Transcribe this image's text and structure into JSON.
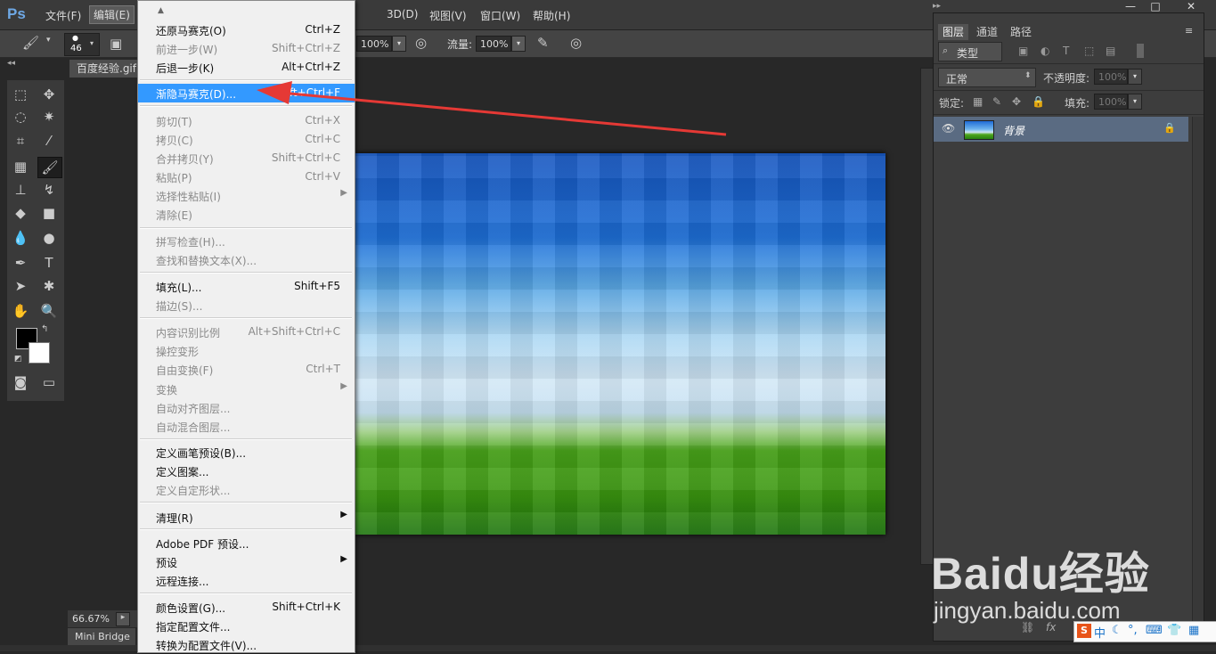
{
  "app": {
    "logo": "Ps",
    "accent": "#6ea8e5"
  },
  "menubar": {
    "items": [
      "文件(F)",
      "编辑(E)",
      "3D(D)",
      "视图(V)",
      "窗口(W)",
      "帮助(H)"
    ],
    "active_index": 1,
    "window_controls": [
      "—",
      "□",
      "✕"
    ]
  },
  "options": {
    "brush_size": "46",
    "opacity_value": "100%",
    "flow_label": "流量:",
    "flow_value": "100%"
  },
  "document": {
    "tab_title": "百度经验.gif",
    "zoom": "66.67%",
    "mini_bridge": "Mini Bridge"
  },
  "edit_menu": {
    "items": [
      {
        "label": "还原马赛克(O)",
        "shortcut": "Ctrl+Z",
        "disabled": false
      },
      {
        "label": "前进一步(W)",
        "shortcut": "Shift+Ctrl+Z",
        "disabled": true
      },
      {
        "label": "后退一步(K)",
        "shortcut": "Alt+Ctrl+Z",
        "disabled": false
      },
      {
        "label": "渐隐马赛克(D)...",
        "shortcut": "Shift+Ctrl+F",
        "disabled": false,
        "highlighted": true
      },
      {
        "label": "剪切(T)",
        "shortcut": "Ctrl+X",
        "disabled": true
      },
      {
        "label": "拷贝(C)",
        "shortcut": "Ctrl+C",
        "disabled": true
      },
      {
        "label": "合并拷贝(Y)",
        "shortcut": "Shift+Ctrl+C",
        "disabled": true
      },
      {
        "label": "粘贴(P)",
        "shortcut": "Ctrl+V",
        "disabled": true
      },
      {
        "label": "选择性粘贴(I)",
        "shortcut": "",
        "disabled": true,
        "submenu": true
      },
      {
        "label": "清除(E)",
        "shortcut": "",
        "disabled": true
      },
      {
        "label": "拼写检查(H)...",
        "shortcut": "",
        "disabled": true
      },
      {
        "label": "查找和替换文本(X)...",
        "shortcut": "",
        "disabled": true
      },
      {
        "label": "填充(L)...",
        "shortcut": "Shift+F5",
        "disabled": false
      },
      {
        "label": "描边(S)...",
        "shortcut": "",
        "disabled": true
      },
      {
        "label": "内容识别比例",
        "shortcut": "Alt+Shift+Ctrl+C",
        "disabled": true
      },
      {
        "label": "操控变形",
        "shortcut": "",
        "disabled": true
      },
      {
        "label": "自由变换(F)",
        "shortcut": "Ctrl+T",
        "disabled": true
      },
      {
        "label": "变换",
        "shortcut": "",
        "disabled": true,
        "submenu": true
      },
      {
        "label": "自动对齐图层...",
        "shortcut": "",
        "disabled": true
      },
      {
        "label": "自动混合图层...",
        "shortcut": "",
        "disabled": true
      },
      {
        "label": "定义画笔预设(B)...",
        "shortcut": "",
        "disabled": false
      },
      {
        "label": "定义图案...",
        "shortcut": "",
        "disabled": false
      },
      {
        "label": "定义自定形状...",
        "shortcut": "",
        "disabled": true
      },
      {
        "label": "清理(R)",
        "shortcut": "",
        "disabled": false,
        "submenu": true
      },
      {
        "label": "Adobe PDF 预设...",
        "shortcut": "",
        "disabled": false
      },
      {
        "label": "预设",
        "shortcut": "",
        "disabled": false,
        "submenu": true
      },
      {
        "label": "远程连接...",
        "shortcut": "",
        "disabled": false
      },
      {
        "label": "颜色设置(G)...",
        "shortcut": "Shift+Ctrl+K",
        "disabled": false
      },
      {
        "label": "指定配置文件...",
        "shortcut": "",
        "disabled": false
      },
      {
        "label": "转换为配置文件(V)...",
        "shortcut": "",
        "disabled": false
      }
    ]
  },
  "layers_panel": {
    "tabs": [
      "图层",
      "通道",
      "路径"
    ],
    "filter_label": "类型",
    "blend_mode": "正常",
    "opacity_label": "不透明度:",
    "opacity_value": "100%",
    "lock_label": "锁定:",
    "fill_label": "填充:",
    "fill_value": "100%",
    "layer_name": "背景"
  },
  "watermark": {
    "line1": "Baidu经验",
    "line2": "jingyan.baidu.com"
  },
  "ime": {
    "label": "中"
  }
}
